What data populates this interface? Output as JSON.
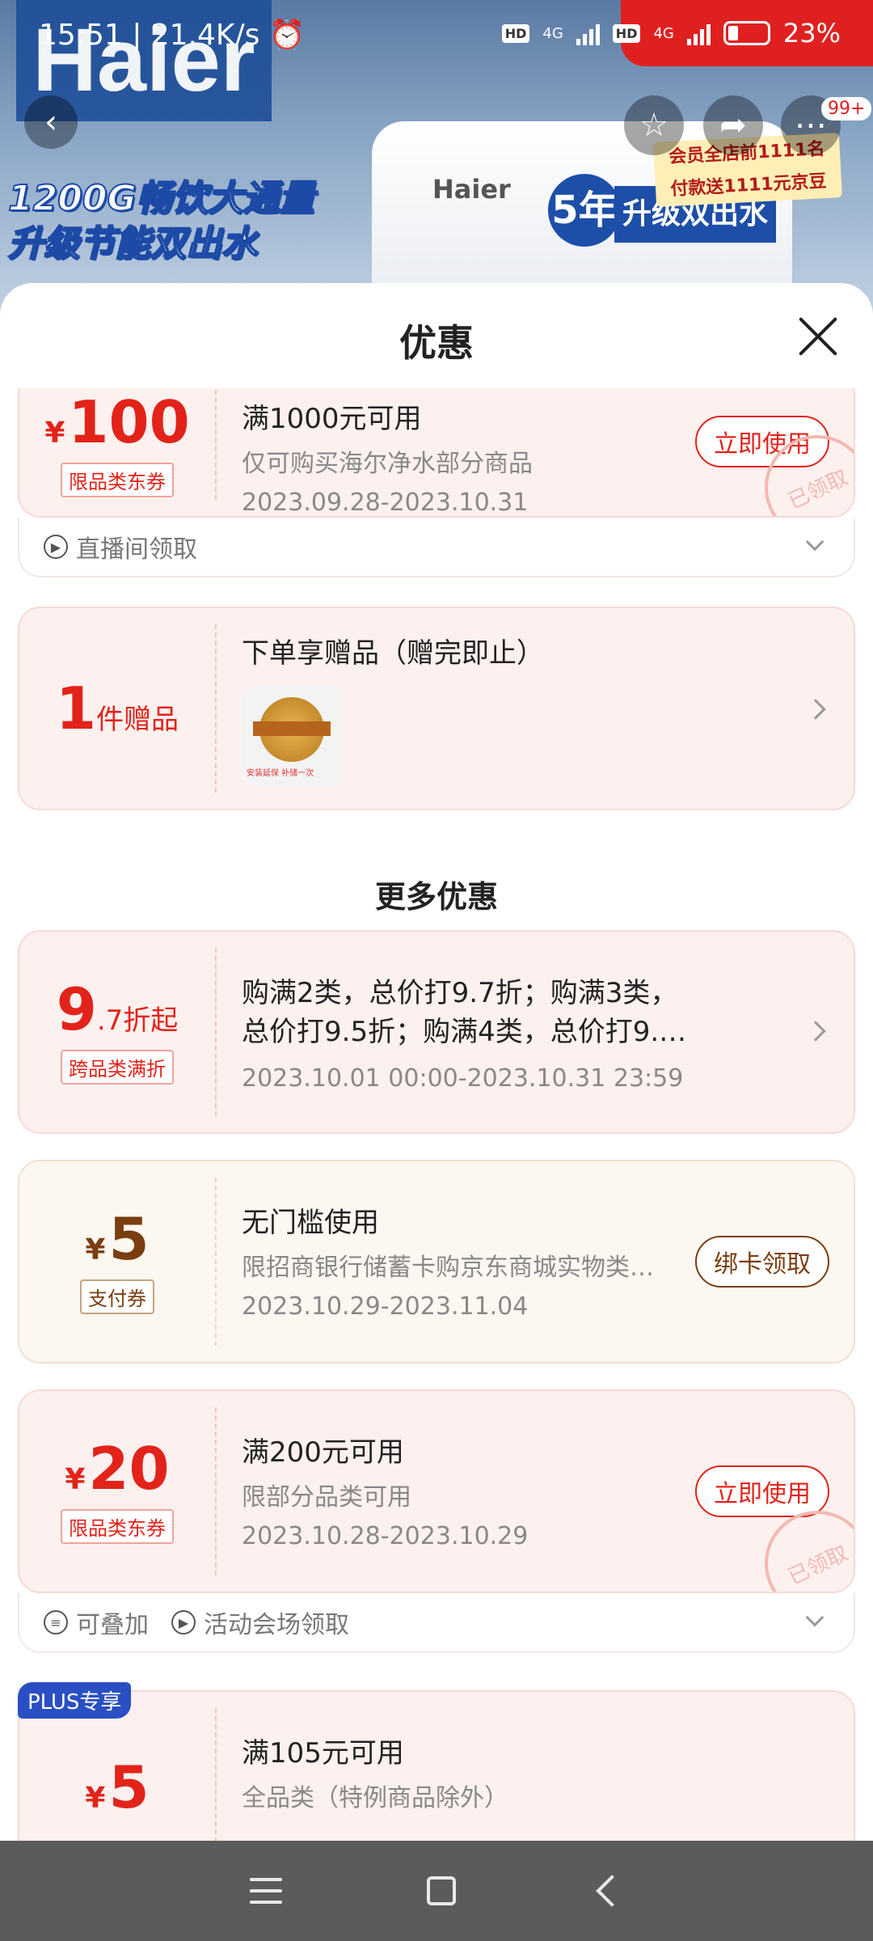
{
  "status_bar": {
    "time": "15:51",
    "speed": "21.4K/s",
    "network1": "4G",
    "network2": "4G",
    "hd": "HD",
    "battery": "23%"
  },
  "background": {
    "brand": "Haier",
    "slogan_line1": "1200G畅饮大通量",
    "slogan_line2": "升级节能双出水",
    "product_brand": "Haier",
    "years_badge": "5年",
    "upgrade_text": "升级双出水",
    "promo_line1": "会员全店前1111名",
    "promo_line2": "付款送1111元京豆",
    "more_badge": "99+"
  },
  "sheet": {
    "title": "优惠"
  },
  "coupons": {
    "c1": {
      "yen": "¥",
      "amount": "100",
      "tag": "限品类东券",
      "title": "满1000元可用",
      "desc": "仅可购买海尔净水部分商品",
      "date": "2023.09.28-2023.10.31",
      "button": "立即使用",
      "stamp": "已领取",
      "footer": "直播间领取"
    },
    "gift": {
      "amount": "1",
      "unit": "件赠品",
      "title": "下单享赠品（赠完即止）",
      "thumb_caption": "安装延保 补储一次"
    },
    "more_heading": "更多优惠",
    "c2": {
      "amount": "9",
      "unit": ".7折起",
      "tag": "跨品类满折",
      "title_line1": "购满2类，总价打9.7折；购满3类，",
      "title_line2": "总价打9.5折；购满4类，总价打9.…",
      "date": "2023.10.01 00:00-2023.10.31 23:59"
    },
    "c3": {
      "yen": "¥",
      "amount": "5",
      "tag": "支付券",
      "title": "无门槛使用",
      "desc": "限招商银行储蓄卡购京东商城实物类…",
      "date": "2023.10.29-2023.11.04",
      "button": "绑卡领取"
    },
    "c4": {
      "yen": "¥",
      "amount": "20",
      "tag": "限品类东券",
      "title": "满200元可用",
      "desc": "限部分品类可用",
      "date": "2023.10.28-2023.10.29",
      "button": "立即使用",
      "stamp": "已领取",
      "footer1": "可叠加",
      "footer2": "活动会场领取"
    },
    "c5": {
      "badge": "PLUS专享",
      "yen": "¥",
      "amount": "5",
      "title": "满105元可用",
      "desc": "全品类（特例商品除外）"
    }
  }
}
